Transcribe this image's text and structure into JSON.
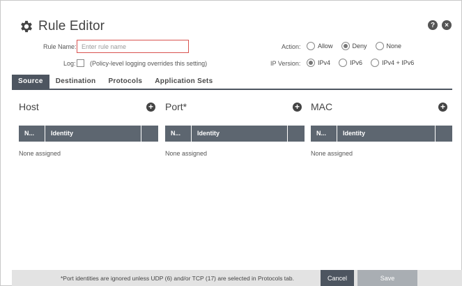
{
  "dialog": {
    "title": "Rule Editor",
    "icons": {
      "help": "?",
      "close": "×"
    }
  },
  "form": {
    "rule_name_label": "Rule Name:",
    "rule_name_placeholder": "Enter rule name",
    "rule_name_value": "",
    "log_label": "Log:",
    "log_note": "(Policy-level logging overrides this setting)",
    "log_checked": false,
    "action_label": "Action:",
    "action_options": [
      "Allow",
      "Deny",
      "None"
    ],
    "action_selected": "Deny",
    "ip_version_label": "IP Version:",
    "ip_version_options": [
      "IPv4",
      "IPv6",
      "IPv4 + IPv6"
    ],
    "ip_version_selected": "IPv4"
  },
  "tabs": [
    {
      "label": "Source",
      "active": true
    },
    {
      "label": "Destination",
      "active": false
    },
    {
      "label": "Protocols",
      "active": false
    },
    {
      "label": "Application Sets",
      "active": false
    }
  ],
  "columns": [
    {
      "title": "Host",
      "col1": "N...",
      "col2": "Identity",
      "empty": "None assigned"
    },
    {
      "title": "Port*",
      "col1": "N...",
      "col2": "Identity",
      "empty": "None assigned"
    },
    {
      "title": "MAC",
      "col1": "N...",
      "col2": "Identity",
      "empty": "None assigned"
    }
  ],
  "footer": {
    "note": "*Port identities are ignored unless UDP (6) and/or TCP (17) are selected in Protocols tab.",
    "cancel_label": "Cancel",
    "save_label": "Save"
  },
  "colors": {
    "tab_active": "#4d5560",
    "table_header": "#5d6670",
    "input_border": "#d9534f",
    "save_disabled": "#a9aeb3"
  }
}
